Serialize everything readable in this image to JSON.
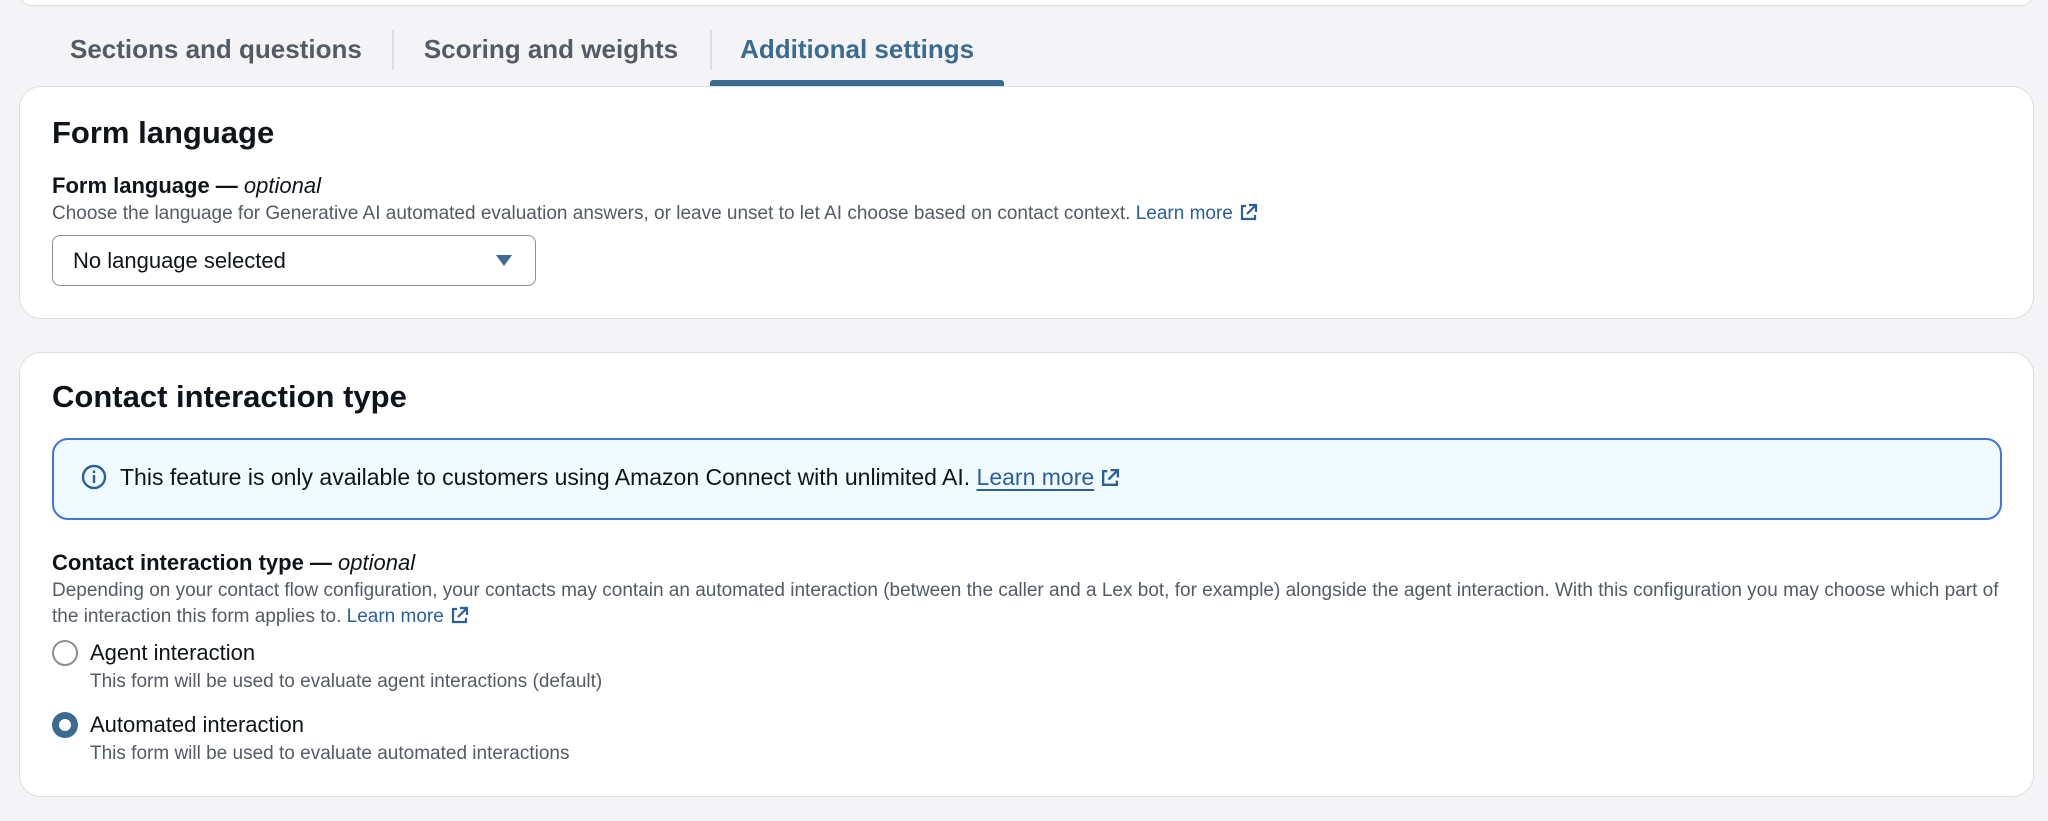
{
  "tabs": [
    {
      "label": "Sections and questions",
      "active": false
    },
    {
      "label": "Scoring and weights",
      "active": false
    },
    {
      "label": "Additional settings",
      "active": true
    }
  ],
  "form_language": {
    "title": "Form language",
    "field_label": "Form language —",
    "optional": "optional",
    "description": "Choose the language for Generative AI automated evaluation answers, or leave unset to let AI choose based on contact context.",
    "learn_more": "Learn more",
    "select_value": "No language selected"
  },
  "contact_interaction": {
    "title": "Contact interaction type",
    "alert_text": "This feature is only available to customers using Amazon Connect with unlimited AI.",
    "alert_link": "Learn more",
    "field_label": "Contact interaction type —",
    "optional": "optional",
    "description": "Depending on your contact flow configuration, your contacts may contain an automated interaction (between the caller and a Lex bot, for example) alongside the agent interaction. With this configuration you may choose which part of the interaction this form applies to.",
    "learn_more": "Learn more",
    "options": [
      {
        "label": "Agent interaction",
        "description": "This form will be used to evaluate agent interactions (default)",
        "checked": false
      },
      {
        "label": "Automated interaction",
        "description": "This form will be used to evaluate automated interactions",
        "checked": true
      }
    ]
  },
  "colors": {
    "accent": "#3b6c8f",
    "link": "#2a5f9e",
    "info_border": "#3f76d8",
    "info_bg": "#f0fbff"
  },
  "icons": {
    "external_link": "external-link-icon",
    "dropdown": "caret-down-icon",
    "info": "info-icon"
  }
}
